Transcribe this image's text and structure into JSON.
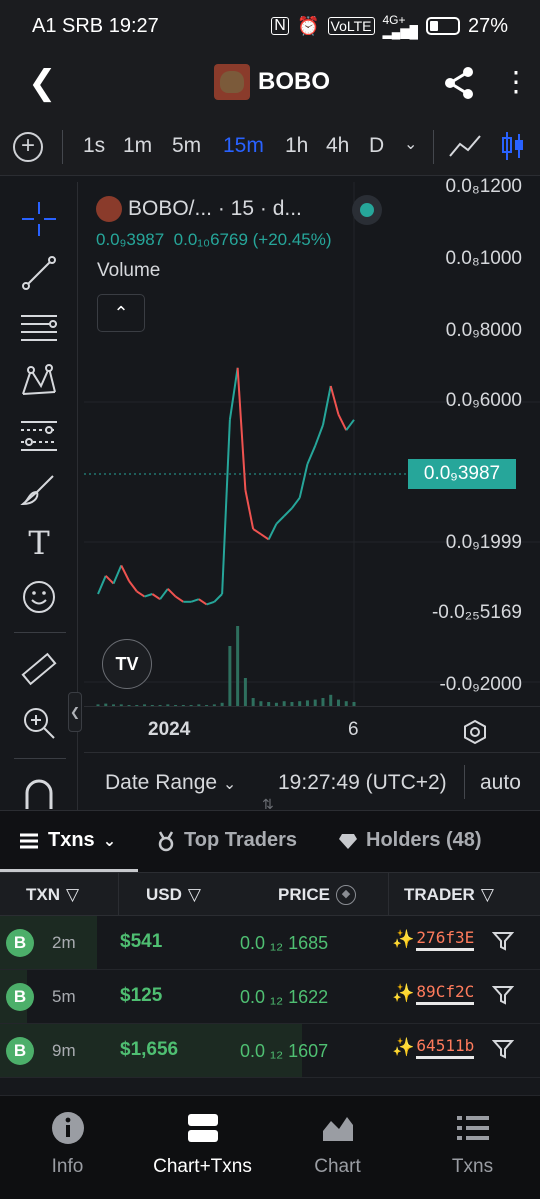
{
  "status_bar": {
    "carrier_time": "A1 SRB 19:27",
    "net_badge": "VoLTE",
    "signal_label": "4G+",
    "battery": "27%"
  },
  "header": {
    "title": "BOBO",
    "icons": [
      "back-arrow-icon",
      "share-icon",
      "more-vertical-icon"
    ]
  },
  "timeframes": {
    "items": [
      "1s",
      "1m",
      "5m",
      "15m",
      "1h",
      "4h",
      "D"
    ],
    "active": "15m"
  },
  "drawing_tools": [
    "crosshair-icon",
    "trend-line-icon",
    "fib-lines-icon",
    "pattern-icon",
    "projection-icon",
    "brush-icon",
    "text-tool-icon",
    "emoji-icon",
    "ruler-icon",
    "zoom-in-icon",
    "magnet-icon"
  ],
  "legend": {
    "title": "BOBO/... · 15 · d...",
    "price": "0.0₉3987",
    "change": "0.0₁₀6769 (+20.45%)",
    "volume_label": "Volume"
  },
  "chart_data": {
    "type": "line",
    "title": "",
    "y_axis_labels": [
      "0.0₈1200",
      "0.0₈1000",
      "0.0₉8000",
      "0.0₉6000",
      "0.0₉3987",
      "0.0₉1999",
      "-0.0₂₅5169",
      "-0.0₉2000"
    ],
    "x_axis_labels": [
      "2024",
      "6"
    ],
    "current_price_tag": "0.0₉3987",
    "price_series": [
      0.05,
      0.12,
      0.09,
      0.16,
      0.1,
      0.06,
      0.04,
      0.05,
      0.03,
      0.07,
      0.04,
      0.02,
      0.02,
      0.03,
      0.01,
      0.02,
      0.05,
      0.72,
      0.92,
      0.45,
      0.3,
      0.28,
      0.26,
      0.32,
      0.35,
      0.38,
      0.42,
      0.55,
      0.62,
      0.7,
      0.85,
      0.74,
      0.68,
      0.72
    ],
    "volume_series": [
      0.02,
      0.03,
      0.02,
      0.02,
      0.01,
      0.01,
      0.02,
      0.01,
      0.01,
      0.02,
      0.01,
      0.01,
      0.01,
      0.02,
      0.01,
      0.02,
      0.04,
      0.75,
      1.0,
      0.35,
      0.1,
      0.06,
      0.05,
      0.04,
      0.06,
      0.05,
      0.06,
      0.07,
      0.08,
      0.1,
      0.14,
      0.08,
      0.06,
      0.05
    ],
    "series_color": "#26a69a",
    "down_color": "#ef5350",
    "grid": true
  },
  "date_range": {
    "label": "Date Range",
    "clock": "19:27:49 (UTC+2)",
    "auto": "auto"
  },
  "tabs": [
    {
      "label": "Txns",
      "icon": "list-icon",
      "active": true
    },
    {
      "label": "Top Traders",
      "icon": "medal-icon",
      "active": false
    },
    {
      "label": "Holders (48)",
      "icon": "diamond-icon",
      "active": false
    }
  ],
  "table": {
    "columns": [
      "TXN",
      "USD",
      "PRICE",
      "TRADER"
    ],
    "rows": [
      {
        "type": "B",
        "age": "2m",
        "usd": "$541",
        "price": "0.0 ₁₂ 1685",
        "trader": "276f3E",
        "bar_fraction": 0.18
      },
      {
        "type": "B",
        "age": "5m",
        "usd": "$125",
        "price": "0.0 ₁₂ 1622",
        "trader": "89Cf2C",
        "bar_fraction": 0.05
      },
      {
        "type": "B",
        "age": "9m",
        "usd": "$1,656",
        "price": "0.0 ₁₂ 1607",
        "trader": "64511b",
        "bar_fraction": 0.56
      }
    ]
  },
  "bottom_nav": [
    {
      "label": "Info",
      "icon": "info-icon",
      "active": false
    },
    {
      "label": "Chart+Txns",
      "icon": "split-view-icon",
      "active": true
    },
    {
      "label": "Chart",
      "icon": "area-chart-icon",
      "active": false
    },
    {
      "label": "Txns",
      "icon": "list-icon",
      "active": false
    }
  ],
  "colors": {
    "accent": "#2962ff",
    "buy": "#4fbf72",
    "price_tag": "#26a69a",
    "trader_address": "#ff7b5c"
  }
}
